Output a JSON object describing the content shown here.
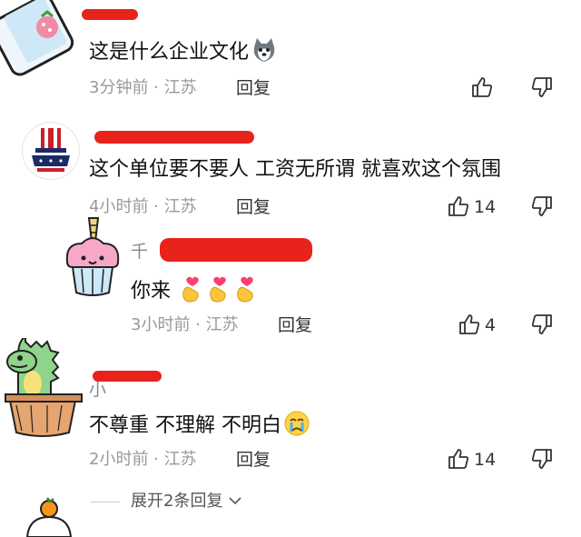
{
  "comments": [
    {
      "username": "",
      "text": "这是什么企业文化",
      "time": "3分钟前",
      "location": "江苏",
      "reply_label": "回复",
      "likes": ""
    },
    {
      "username": "",
      "text": "这个单位要不要人 工资无所谓 就喜欢这个氛围",
      "time": "4小时前",
      "location": "江苏",
      "reply_label": "回复",
      "likes": "14"
    },
    {
      "username": "千",
      "text": "你来",
      "time": "3小时前",
      "location": "江苏",
      "reply_label": "回复",
      "likes": "4"
    },
    {
      "username": "小",
      "text": "不尊重 不理解 不明白",
      "time": "2小时前",
      "location": "江苏",
      "reply_label": "回复",
      "likes": "14"
    }
  ],
  "separator": " · ",
  "expand_replies": "展开2条回复",
  "colors": {
    "scribble": "#e8231b",
    "meta": "#999999"
  }
}
